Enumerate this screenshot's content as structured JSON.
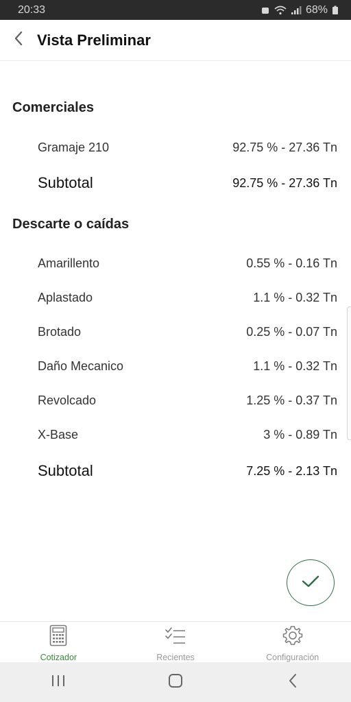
{
  "status_bar": {
    "time": "20:33",
    "battery": "68%"
  },
  "app_bar": {
    "title": "Vista Preliminar"
  },
  "sections": [
    {
      "title": "Comerciales",
      "rows": [
        {
          "label": "Gramaje 210",
          "value": "92.75 % - 27.36 Tn"
        }
      ],
      "subtotal": {
        "label": "Subtotal",
        "value": "92.75 % - 27.36 Tn"
      }
    },
    {
      "title": "Descarte o caídas",
      "rows": [
        {
          "label": "Amarillento",
          "value": "0.55 % - 0.16 Tn"
        },
        {
          "label": "Aplastado",
          "value": "1.1 % - 0.32 Tn"
        },
        {
          "label": "Brotado",
          "value": "0.25 % - 0.07 Tn"
        },
        {
          "label": "Daño Mecanico",
          "value": "1.1 % - 0.32 Tn"
        },
        {
          "label": "Revolcado",
          "value": "1.25 % - 0.37 Tn"
        },
        {
          "label": "X-Base",
          "value": "3 % - 0.89 Tn"
        }
      ],
      "subtotal": {
        "label": "Subtotal",
        "value": "7.25 % - 2.13 Tn"
      }
    }
  ],
  "bottom_nav": {
    "items": [
      {
        "label": "Cotizador",
        "icon": "calculator-icon",
        "active": true
      },
      {
        "label": "Recientes",
        "icon": "checklist-icon",
        "active": false
      },
      {
        "label": "Configuración",
        "icon": "gear-icon",
        "active": false
      }
    ]
  },
  "colors": {
    "accent": "#3a8a3a",
    "fab_border": "#2e6d44",
    "inactive": "#9a9a9a"
  }
}
